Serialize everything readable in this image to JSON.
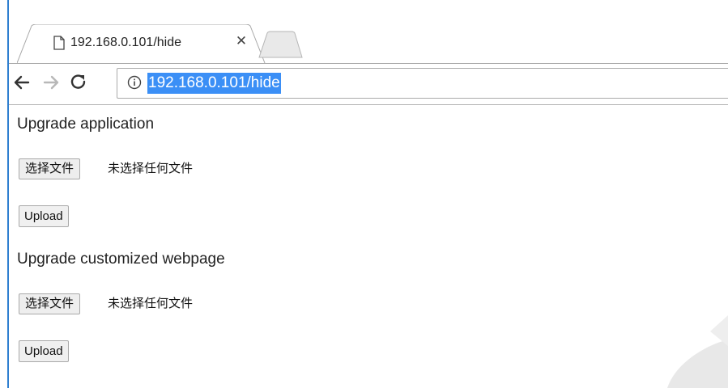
{
  "browser": {
    "tab": {
      "title": "192.168.0.101/hide",
      "close_icon": "close-icon",
      "page_icon": "page-icon"
    },
    "toolbar": {
      "back_icon": "back-arrow-icon",
      "forward_icon": "forward-arrow-icon",
      "reload_icon": "reload-icon",
      "info_icon": "info-icon",
      "url": "192.168.0.101/hide",
      "url_selected": true
    }
  },
  "page": {
    "sections": [
      {
        "heading": "Upgrade application",
        "file_button_label": "选择文件",
        "file_status": "未选择任何文件",
        "upload_label": "Upload"
      },
      {
        "heading": "Upgrade customized webpage",
        "file_button_label": "选择文件",
        "file_status": "未选择任何文件",
        "upload_label": "Upload"
      }
    ]
  },
  "colors": {
    "selection_highlight": "#3b8ff6",
    "left_edge": "#2f7fd0",
    "watermark": "#e8e8e8"
  }
}
